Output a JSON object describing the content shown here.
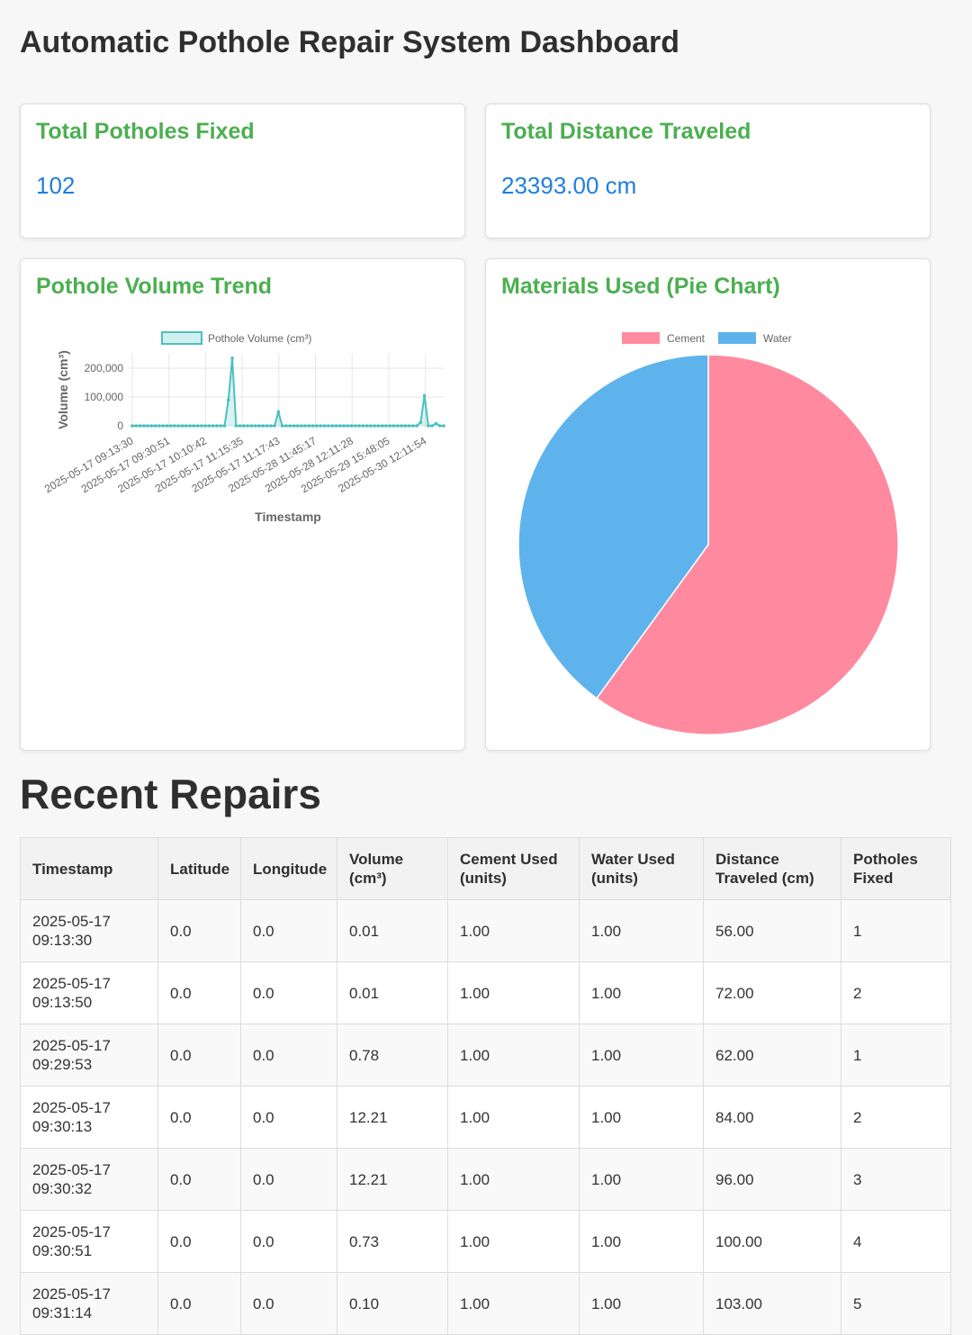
{
  "page": {
    "title": "Automatic Pothole Repair System Dashboard"
  },
  "stats": {
    "fixed": {
      "title": "Total Potholes Fixed",
      "value": "102"
    },
    "distance": {
      "title": "Total Distance Traveled",
      "value": "23393.00 cm"
    }
  },
  "trend_card": {
    "title": "Pothole Volume Trend"
  },
  "pie_card": {
    "title": "Materials Used (Pie Chart)"
  },
  "chart_data": [
    {
      "type": "area",
      "legend": [
        "Pothole Volume (cm³)"
      ],
      "xlabel": "Timestamp",
      "ylabel": "Volume (cm³)",
      "ylim": [
        0,
        250000
      ],
      "yticks": [
        "0",
        "100,000",
        "200,000"
      ],
      "ytick_values": [
        0,
        100000,
        200000
      ],
      "xtick_labels": [
        "2025-05-17 09:13:30",
        "2025-05-17 09:30:51",
        "2025-05-17 10:10:42",
        "2025-05-17 11:15:35",
        "2025-05-17 11:17:43",
        "2025-05-28 11:45:17",
        "2025-05-28 12:11:28",
        "2025-05-29 15:48:05",
        "2025-05-30 12:11:54"
      ],
      "series": [
        {
          "name": "Pothole Volume (cm³)",
          "color": "#4bc0c0",
          "values": [
            0.01,
            0.01,
            0.78,
            12.21,
            12.21,
            0.73,
            0.1,
            0,
            0,
            0,
            0,
            0,
            0,
            0,
            0,
            0,
            0,
            0,
            0,
            0,
            0,
            0,
            0,
            0,
            0,
            90000,
            235000,
            0,
            0,
            0,
            0,
            0,
            0,
            0,
            0,
            0,
            0,
            0,
            48000,
            0,
            0,
            0,
            0,
            0,
            0,
            0,
            0,
            0,
            0,
            0,
            0,
            0,
            0,
            0,
            0,
            0,
            0,
            0,
            0,
            0,
            0,
            0,
            0,
            0,
            0,
            0,
            0,
            0,
            0,
            0,
            0,
            0,
            0,
            0,
            0,
            12000,
            105000,
            0,
            0,
            8000,
            0,
            0
          ]
        }
      ],
      "grid": true,
      "legend_position": "top"
    },
    {
      "type": "pie",
      "categories": [
        "Cement",
        "Water"
      ],
      "values": [
        60,
        40
      ],
      "colors": [
        "#ff8aa0",
        "#5eb3ec"
      ],
      "legend_position": "top"
    }
  ],
  "table": {
    "title": "Recent Repairs",
    "headers": [
      "Timestamp",
      "Latitude",
      "Longitude",
      "Volume (cm³)",
      "Cement Used (units)",
      "Water Used (units)",
      "Distance Traveled (cm)",
      "Potholes Fixed"
    ],
    "rows": [
      [
        "2025-05-17 09:13:30",
        "0.0",
        "0.0",
        "0.01",
        "1.00",
        "1.00",
        "56.00",
        "1"
      ],
      [
        "2025-05-17 09:13:50",
        "0.0",
        "0.0",
        "0.01",
        "1.00",
        "1.00",
        "72.00",
        "2"
      ],
      [
        "2025-05-17 09:29:53",
        "0.0",
        "0.0",
        "0.78",
        "1.00",
        "1.00",
        "62.00",
        "1"
      ],
      [
        "2025-05-17 09:30:13",
        "0.0",
        "0.0",
        "12.21",
        "1.00",
        "1.00",
        "84.00",
        "2"
      ],
      [
        "2025-05-17 09:30:32",
        "0.0",
        "0.0",
        "12.21",
        "1.00",
        "1.00",
        "96.00",
        "3"
      ],
      [
        "2025-05-17 09:30:51",
        "0.0",
        "0.0",
        "0.73",
        "1.00",
        "1.00",
        "100.00",
        "4"
      ],
      [
        "2025-05-17 09:31:14",
        "0.0",
        "0.0",
        "0.10",
        "1.00",
        "1.00",
        "103.00",
        "5"
      ]
    ]
  }
}
